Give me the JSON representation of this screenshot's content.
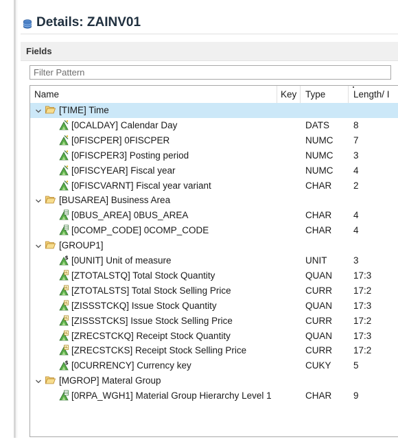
{
  "window": {
    "title": "Details: ZAINV01"
  },
  "section": {
    "label": "Fields"
  },
  "filter": {
    "placeholder": "Filter Pattern",
    "value": ""
  },
  "columns": {
    "name": "Name",
    "key": "Key",
    "type": "Type",
    "length": "Length/ I"
  },
  "colors": {
    "selected_row": "#cce8f8",
    "folder": "#e8b84a",
    "field_icon": "#3d9a3d"
  },
  "rows": [
    {
      "kind": "group",
      "name": "[TIME] Time",
      "expanded": true,
      "icon": "folder-open-icon"
    },
    {
      "kind": "field",
      "name": "[0CALDAY] Calendar Day",
      "type": "DATS",
      "length": "8",
      "icon": "characteristic-icon"
    },
    {
      "kind": "field",
      "name": "[0FISCPER] 0FISCPER",
      "type": "NUMC",
      "length": "7",
      "icon": "characteristic-icon"
    },
    {
      "kind": "field",
      "name": "[0FISCPER3] Posting period",
      "type": "NUMC",
      "length": "3",
      "icon": "characteristic-icon"
    },
    {
      "kind": "field",
      "name": "[0FISCYEAR] Fiscal year",
      "type": "NUMC",
      "length": "4",
      "icon": "characteristic-icon"
    },
    {
      "kind": "field",
      "name": "[0FISCVARNT] Fiscal year variant",
      "type": "CHAR",
      "length": "2",
      "icon": "characteristic-icon"
    },
    {
      "kind": "group",
      "name": "[BUSAREA] Business Area",
      "expanded": true,
      "icon": "folder-open-icon"
    },
    {
      "kind": "field",
      "name": "[0BUS_AREA] 0BUS_AREA",
      "type": "CHAR",
      "length": "4",
      "icon": "characteristic-table-icon"
    },
    {
      "kind": "field",
      "name": "[0COMP_CODE] 0COMP_CODE",
      "type": "CHAR",
      "length": "4",
      "icon": "characteristic-table-icon"
    },
    {
      "kind": "group",
      "name": "[GROUP1]",
      "expanded": true,
      "icon": "folder-open-icon"
    },
    {
      "kind": "field",
      "name": "[0UNIT] Unit of measure",
      "type": "UNIT",
      "length": "3",
      "icon": "unit-icon"
    },
    {
      "kind": "field",
      "name": "[ZTOTALSTQ] Total Stock Quantity",
      "type": "QUAN",
      "length": "17:3",
      "icon": "key-figure-icon"
    },
    {
      "kind": "field",
      "name": "[ZTOTALSTS] Total Stock Selling Price",
      "type": "CURR",
      "length": "17:2",
      "icon": "key-figure-icon"
    },
    {
      "kind": "field",
      "name": "[ZISSSTCKQ] Issue Stock Quantity",
      "type": "QUAN",
      "length": "17:3",
      "icon": "key-figure-icon"
    },
    {
      "kind": "field",
      "name": "[ZISSSTCKS] Issue Stock Selling Price",
      "type": "CURR",
      "length": "17:2",
      "icon": "key-figure-icon"
    },
    {
      "kind": "field",
      "name": "[ZRECSTCKQ] Receipt Stock Quantity",
      "type": "QUAN",
      "length": "17:3",
      "icon": "key-figure-icon"
    },
    {
      "kind": "field",
      "name": "[ZRECSTCKS] Receipt Stock Selling Price",
      "type": "CURR",
      "length": "17:2",
      "icon": "key-figure-icon"
    },
    {
      "kind": "field",
      "name": "[0CURRENCY] Currency key",
      "type": "CUKY",
      "length": "5",
      "icon": "unit-icon"
    },
    {
      "kind": "group",
      "name": "[MGROP] Materal Group",
      "expanded": true,
      "icon": "folder-open-icon"
    },
    {
      "kind": "field",
      "name": "[0RPA_WGH1] Material Group Hierarchy Level 1",
      "type": "CHAR",
      "length": "9",
      "icon": "characteristic-table-icon"
    }
  ]
}
